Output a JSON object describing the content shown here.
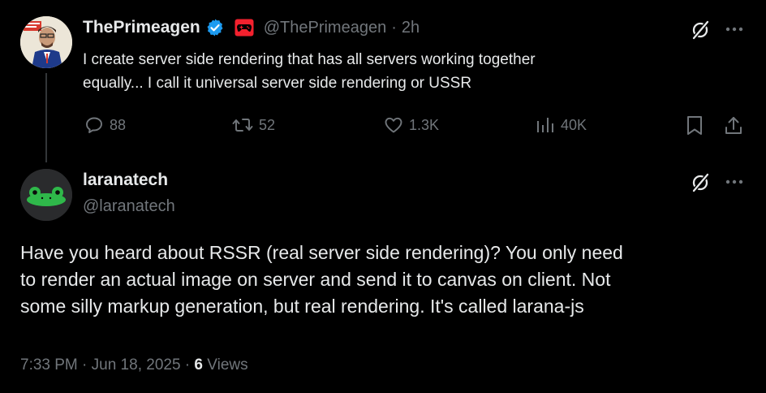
{
  "parent_tweet": {
    "author_name": "ThePrimeagen",
    "handle": "@ThePrimeagen",
    "separator": "·",
    "time": "2h",
    "text_line1": "I  create server side rendering that has all servers working together",
    "text_line2": "equally... I call it universal server side rendering or USSR",
    "stats": {
      "replies": "88",
      "reposts": "52",
      "likes": "1.3K",
      "views": "40K"
    }
  },
  "reply_tweet": {
    "author_name": "laranatech",
    "handle": "@laranatech",
    "text_line1": "Have you heard about RSSR (real server side rendering)? You only need",
    "text_line2": "to render an actual image on server and send it to canvas on client. Not",
    "text_line3": "some silly markup generation, but real rendering. It's called larana-js",
    "timestamp": "7:33 PM · Jun 18, 2025 ·",
    "views_count": "6",
    "views_label": "Views"
  },
  "colors": {
    "background": "#000000",
    "text": "#e7e9ea",
    "muted": "#71767b",
    "verified": "#1d9bf0",
    "affiliate_badge": "#f4212e",
    "frog_green": "#2fb84a"
  }
}
